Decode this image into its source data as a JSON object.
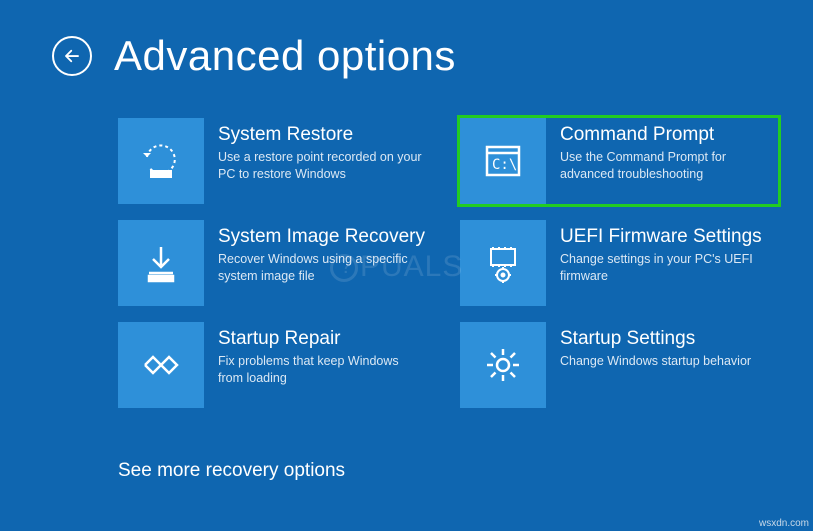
{
  "header": {
    "title": "Advanced options"
  },
  "tiles": [
    {
      "title": "System Restore",
      "desc": "Use a restore point recorded on your PC to restore Windows"
    },
    {
      "title": "Command Prompt",
      "desc": "Use the Command Prompt for advanced troubleshooting"
    },
    {
      "title": "System Image Recovery",
      "desc": "Recover Windows using a specific system image file"
    },
    {
      "title": "UEFI Firmware Settings",
      "desc": "Change settings in your PC's UEFI firmware"
    },
    {
      "title": "Startup Repair",
      "desc": "Fix problems that keep Windows from loading"
    },
    {
      "title": "Startup Settings",
      "desc": "Change Windows startup behavior"
    }
  ],
  "more_link": "See more recovery options",
  "watermark": "PUALS",
  "attribution": "wsxdn.com",
  "colors": {
    "bg": "#0f66b0",
    "tile": "#2e90d9",
    "highlight": "#22cc22"
  }
}
